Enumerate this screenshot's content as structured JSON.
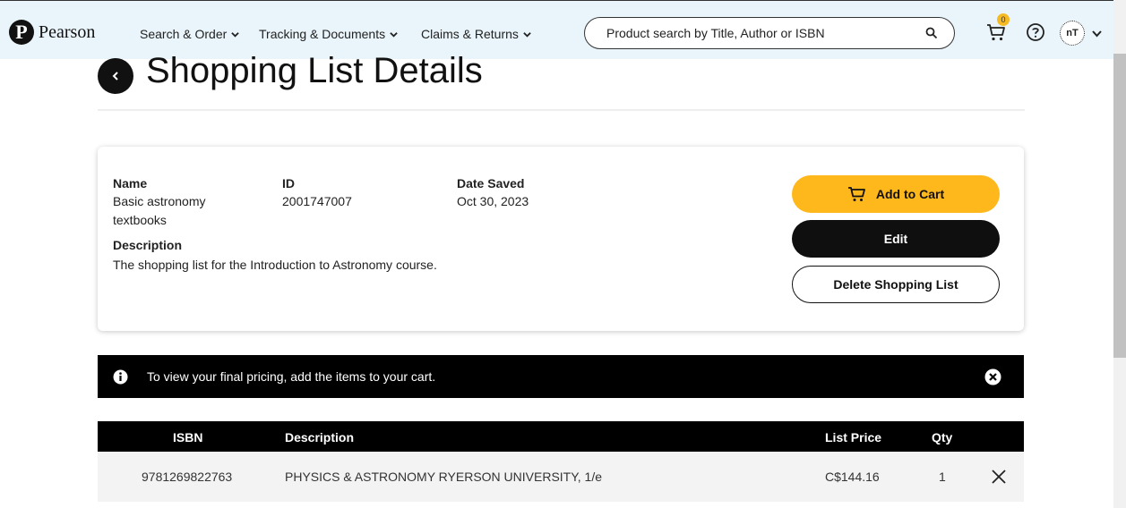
{
  "header": {
    "logo_text": "Pearson",
    "nav": [
      "Search & Order",
      "Tracking & Documents",
      "Claims & Returns"
    ],
    "search_placeholder": "Product search by Title, Author or ISBN",
    "cart_count": "0",
    "avatar_initials": "nT"
  },
  "page": {
    "title": "Shopping List Details"
  },
  "details": {
    "name_label": "Name",
    "name_value_line1": "Basic astronomy",
    "name_value_line2": "textbooks",
    "id_label": "ID",
    "id_value": "2001747007",
    "date_label": "Date Saved",
    "date_value": "Oct 30, 2023",
    "description_label": "Description",
    "description_value": "The shopping list for the Introduction to Astronomy course."
  },
  "actions": {
    "add_to_cart": "Add to Cart",
    "edit": "Edit",
    "delete": "Delete Shopping List"
  },
  "banner": {
    "message": "To view your final pricing, add the items to your cart."
  },
  "table": {
    "headers": {
      "isbn": "ISBN",
      "description": "Description",
      "list_price": "List Price",
      "qty": "Qty"
    },
    "rows": [
      {
        "isbn": "9781269822763",
        "description": "PHYSICS & ASTRONOMY RYERSON UNIVERSITY, 1/e",
        "list_price": "C$144.16",
        "qty": "1"
      }
    ]
  },
  "colors": {
    "accent": "#ffb81c",
    "header_bg": "#eaf5fb",
    "dark": "#000000"
  }
}
